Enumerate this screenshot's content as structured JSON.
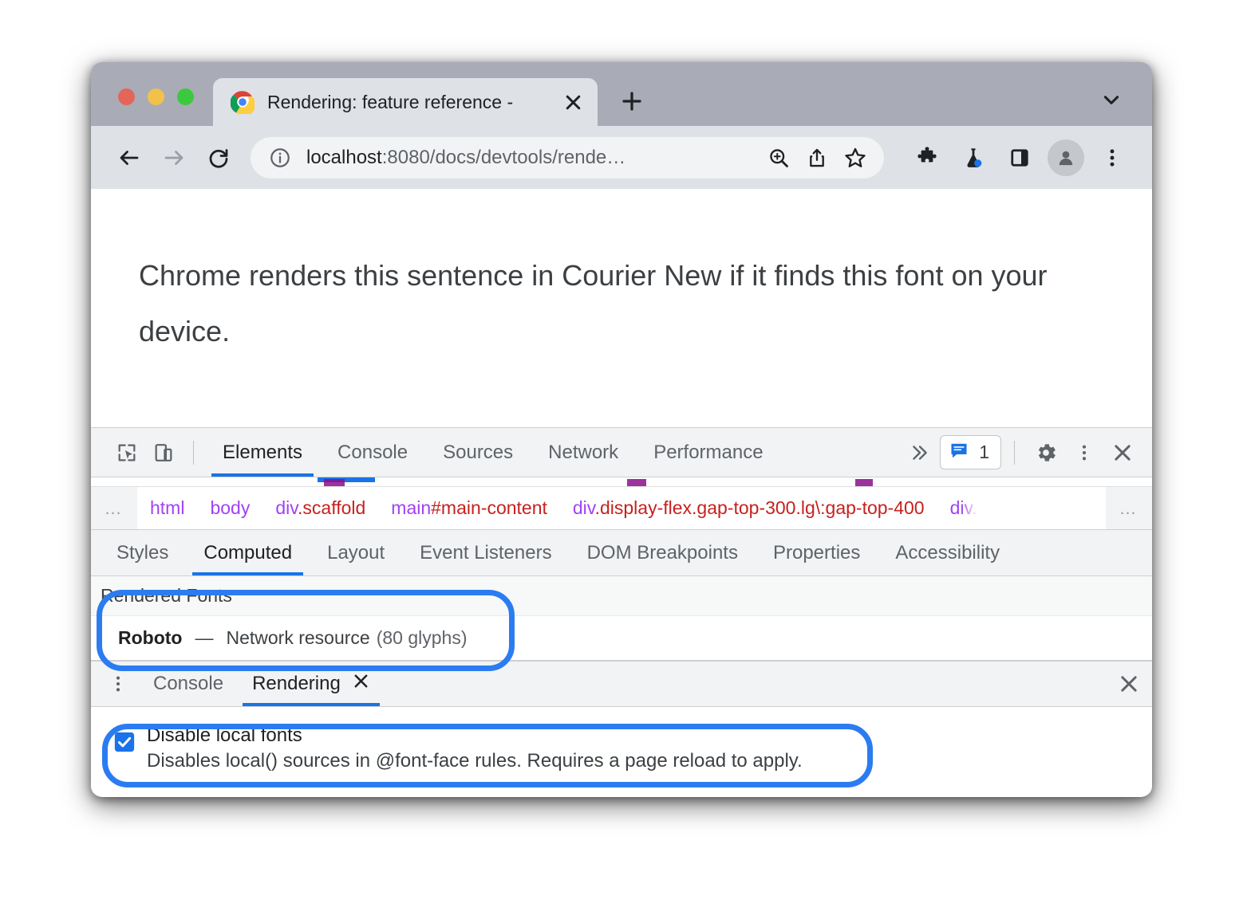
{
  "browser": {
    "tab": {
      "title": "Rendering: feature reference - ",
      "favicon": "chrome-logo-icon",
      "close_icon": "close-icon"
    },
    "new_tab_icon": "plus-icon",
    "tab_list_icon": "chevron-down-icon",
    "traffic_lights": [
      "close-red",
      "minimize-yellow",
      "maximize-green"
    ],
    "nav": {
      "back_icon": "back-arrow-icon",
      "forward_icon": "forward-arrow-icon",
      "reload_icon": "reload-icon"
    },
    "omnibox": {
      "site_info_icon": "info-circle-icon",
      "url_host": "localhost",
      "url_path": ":8080/docs/devtools/rende…",
      "zoom_icon": "zoom-in-icon",
      "share_icon": "share-icon",
      "bookmark_icon": "star-icon"
    },
    "toolbar_right": {
      "extensions_icon": "puzzle-icon",
      "experiments_icon": "flask-icon",
      "side_panel_icon": "side-panel-icon",
      "profile_icon": "avatar-icon",
      "menu_icon": "three-dot-menu-icon"
    }
  },
  "page": {
    "sentence": "Chrome renders this sentence in Courier New if it finds this font on your device."
  },
  "devtools": {
    "inspect_icon": "inspect-cursor-icon",
    "device_toolbar_icon": "device-toggle-icon",
    "tabs": [
      {
        "label": "Elements",
        "active": true
      },
      {
        "label": "Console",
        "active": false
      },
      {
        "label": "Sources",
        "active": false
      },
      {
        "label": "Network",
        "active": false
      },
      {
        "label": "Performance",
        "active": false
      }
    ],
    "more_tabs_icon": "chevron-double-right-icon",
    "issues": {
      "icon": "issues-message-icon",
      "count": "1"
    },
    "settings_icon": "gear-icon",
    "menu_icon": "three-dot-menu-icon",
    "close_icon": "close-icon",
    "breadcrumb": {
      "overflow_left": "…",
      "overflow_right": "…",
      "items": [
        {
          "tag": "html",
          "cls": ""
        },
        {
          "tag": "body",
          "cls": ""
        },
        {
          "tag": "div",
          "cls": ".scaffold"
        },
        {
          "tag": "main",
          "cls": "#main-content"
        },
        {
          "tag": "div",
          "cls": ".display-flex.gap-top-300.lg\\:gap-top-400"
        },
        {
          "tag": "div",
          "cls": "."
        }
      ]
    },
    "pane_tabs": [
      {
        "label": "Styles",
        "active": false
      },
      {
        "label": "Computed",
        "active": true
      },
      {
        "label": "Layout",
        "active": false
      },
      {
        "label": "Event Listeners",
        "active": false
      },
      {
        "label": "DOM Breakpoints",
        "active": false
      },
      {
        "label": "Properties",
        "active": false
      },
      {
        "label": "Accessibility",
        "active": false
      }
    ],
    "computed": {
      "rendered_fonts_header": "Rendered Fonts",
      "font_name": "Roboto",
      "font_dash": "—",
      "font_source": "Network resource",
      "font_glyphs": "(80 glyphs)"
    },
    "drawer": {
      "more_icon": "three-dot-menu-icon",
      "tabs": [
        {
          "label": "Console",
          "active": false,
          "closable": false
        },
        {
          "label": "Rendering",
          "active": true,
          "closable": true
        }
      ],
      "tab_close_icon": "close-icon",
      "close_icon": "close-icon",
      "rendering": {
        "disable_local_fonts_title": "Disable local fonts",
        "disable_local_fonts_desc": "Disables local() sources in @font-face rules. Requires a page reload to apply.",
        "disable_local_fonts_checked": true
      }
    }
  },
  "annotations": {
    "color": "#2b7cf0",
    "rings": [
      "rendered-fonts-ring",
      "disable-local-fonts-ring"
    ]
  }
}
